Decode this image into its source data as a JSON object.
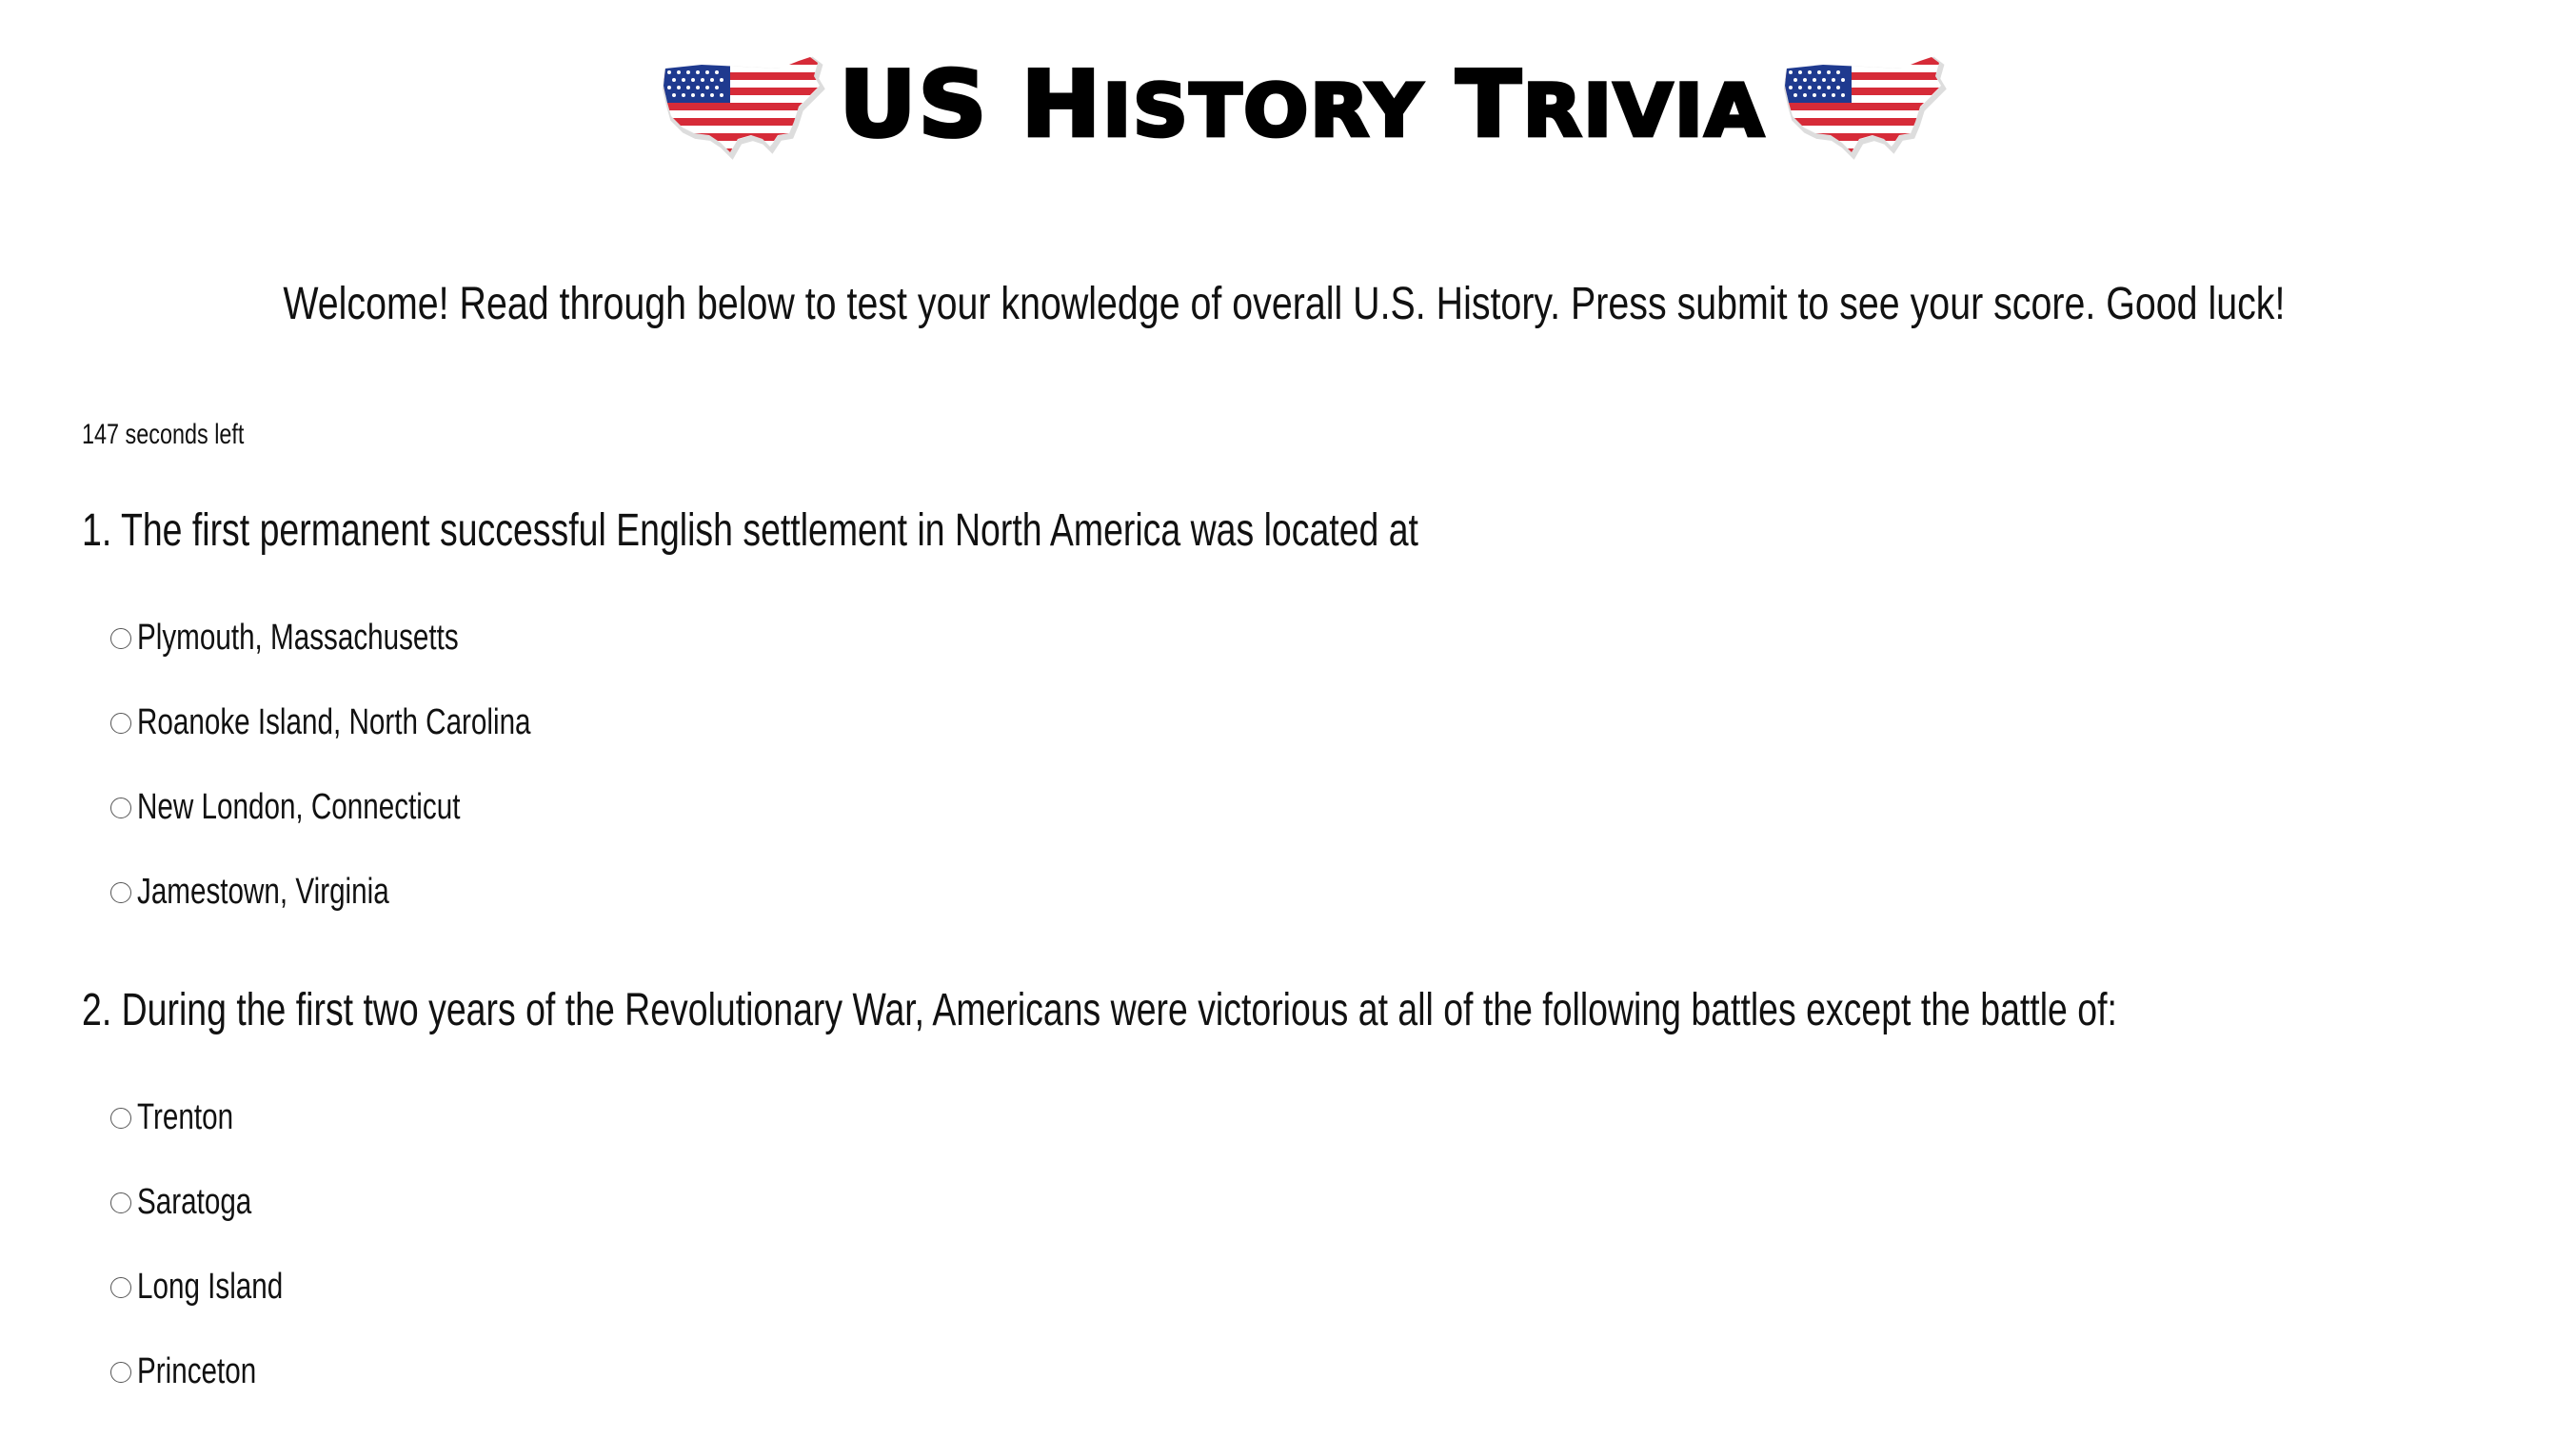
{
  "header": {
    "title_parts": [
      "US",
      "H",
      "ISTORY",
      "T",
      "RIVIA"
    ],
    "left_icon": "us-flag-map-icon",
    "right_icon": "us-flag-map-icon"
  },
  "welcome_text": "Welcome! Read through below to test your knowledge of overall U.S. History. Press submit to see your score. Good luck!",
  "timer_text": "147 seconds left",
  "questions": [
    {
      "text": "1. The first permanent successful English settlement in North America was located at",
      "options": [
        "Plymouth, Massachusetts",
        "Roanoke Island, North Carolina",
        "New London, Connecticut",
        "Jamestown, Virginia"
      ]
    },
    {
      "text": "2. During the first two years of the Revolutionary War, Americans were victorious at all of the following battles except the battle of:",
      "options": [
        "Trenton",
        "Saratoga",
        "Long Island",
        "Princeton"
      ]
    }
  ],
  "colors": {
    "flag_red": "#d62b38",
    "flag_blue": "#1f3a8f",
    "text": "#111111"
  }
}
